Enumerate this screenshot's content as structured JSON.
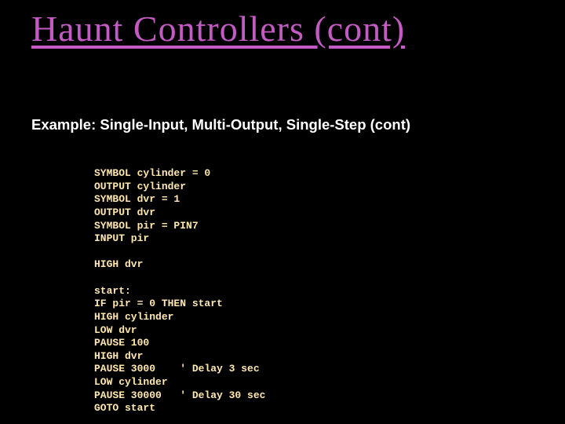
{
  "title": "Haunt Controllers (cont)",
  "subtitle": "Example:  Single-Input, Multi-Output, Single-Step (cont)",
  "code": "SYMBOL cylinder = 0\nOUTPUT cylinder\nSYMBOL dvr = 1\nOUTPUT dvr\nSYMBOL pir = PIN7\nINPUT pir\n\nHIGH dvr\n\nstart:\nIF pir = 0 THEN start\nHIGH cylinder\nLOW dvr\nPAUSE 100\nHIGH dvr\nPAUSE 3000    ' Delay 3 sec\nLOW cylinder\nPAUSE 30000   ' Delay 30 sec\nGOTO start"
}
